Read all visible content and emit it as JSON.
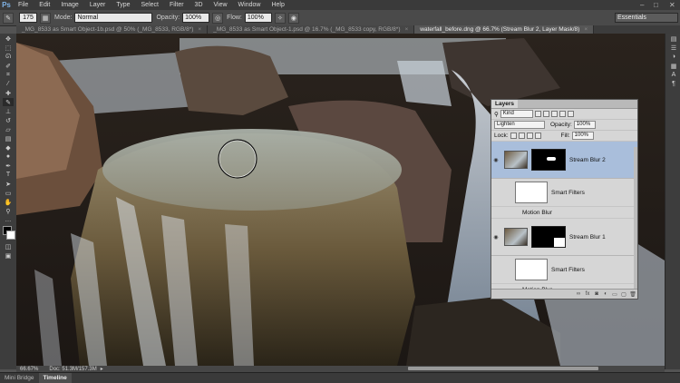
{
  "menubar": {
    "logo": "Ps",
    "items": [
      "File",
      "Edit",
      "Image",
      "Layer",
      "Type",
      "Select",
      "Filter",
      "3D",
      "View",
      "Window",
      "Help"
    ],
    "window_controls": [
      "–",
      "□",
      "✕"
    ]
  },
  "options": {
    "brush_size": "175",
    "mode_label": "Mode:",
    "mode_value": "Normal",
    "opacity_label": "Opacity:",
    "opacity_value": "100%",
    "flow_label": "Flow:",
    "flow_value": "100%",
    "workspace": "Essentials"
  },
  "tabs": [
    {
      "label": "_MG_8533 as Smart Object-1b.psd @ 50% (_MG_8533, RGB/8*)",
      "close": "×"
    },
    {
      "label": "_MG_8533 as Smart Object-1.psd @ 16.7% (_MG_8533 copy, RGB/8*)",
      "close": "×"
    },
    {
      "label": "waterfall_before.dng @ 66.7% (Stream Blur 2, Layer Mask/8)",
      "close": "×"
    }
  ],
  "status": {
    "zoom": "66.67%",
    "doc": "Doc: 51.3M/157.3M"
  },
  "bottom_tabs": [
    "Mini Bridge",
    "Timeline"
  ],
  "layers_panel": {
    "title": "Layers",
    "filter": "Kind",
    "blend_mode": "Lighten",
    "opacity_label": "Opacity:",
    "opacity_value": "100%",
    "lock_label": "Lock:",
    "fill_label": "Fill:",
    "fill_value": "100%",
    "layers": [
      {
        "name": "Stream Blur 2",
        "smart_filters": "Smart Filters",
        "filter": "Motion Blur"
      },
      {
        "name": "Stream Blur 1",
        "smart_filters": "Smart Filters",
        "filter": "Motion Blur"
      }
    ]
  },
  "colors": {
    "selected_layer": "#a9bedb",
    "ps_blue": "#7fb2e5"
  }
}
